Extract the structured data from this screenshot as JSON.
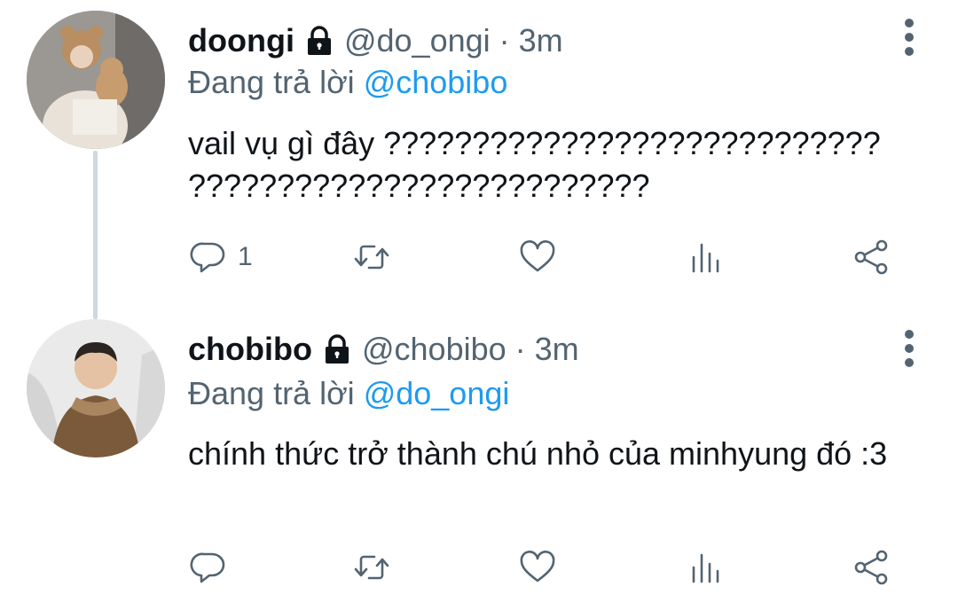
{
  "tweets": [
    {
      "name": "doongi",
      "handle": "@do_ongi",
      "separator": "·",
      "time": "3m",
      "reply_prefix": "Đang trả lời ",
      "reply_mention": "@chobibo",
      "text": "vail vụ gì đây ???????????????????????????? ??????????????????????????",
      "reply_count": "1",
      "icons": [
        "lock-icon",
        "more-vertical-icon",
        "reply-icon",
        "retweet-icon",
        "like-icon",
        "stats-icon",
        "share-icon"
      ]
    },
    {
      "name": "chobibo",
      "handle": "@chobibo",
      "separator": "·",
      "time": "3m",
      "reply_prefix": "Đang trả lời ",
      "reply_mention": "@do_ongi",
      "text": "chính thức trở thành chú nhỏ của minhyung đó :3",
      "reply_count": "",
      "icons": [
        "lock-icon",
        "more-vertical-icon",
        "reply-icon",
        "retweet-icon",
        "like-icon",
        "stats-icon",
        "share-icon"
      ]
    }
  ],
  "colors": {
    "text": "#0f1419",
    "secondary": "#536471",
    "mention": "#1d9bf0",
    "thread_line": "#cfd9de",
    "background": "#ffffff"
  }
}
